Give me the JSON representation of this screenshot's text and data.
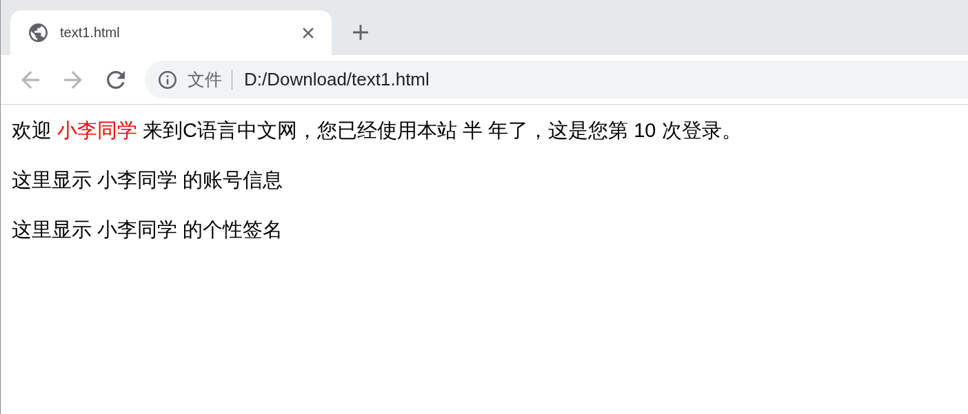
{
  "tabs": [
    {
      "title": "text1.html",
      "selected": true
    }
  ],
  "nav_buttons": [
    {
      "kind": "back",
      "disabled": true
    },
    {
      "kind": "forward",
      "disabled": true
    },
    {
      "kind": "reload",
      "disabled": false
    }
  ],
  "address_bar": {
    "security_label": "文件",
    "url": "D:/Download/text1.html"
  },
  "page": {
    "paragraphs": [
      {
        "segments": [
          {
            "text": "欢迎 ",
            "color": "#000000"
          },
          {
            "text": "小李同学",
            "color": "#ff0000"
          },
          {
            "text": " 来到C语言中文网，您已经使用本站 半 年了，这是您第 10 次登录。",
            "color": "#000000"
          }
        ]
      },
      {
        "segments": [
          {
            "text": "这里显示 小李同学 的账号信息",
            "color": "#000000"
          }
        ]
      },
      {
        "segments": [
          {
            "text": "这里显示 小李同学 的个性签名",
            "color": "#000000"
          }
        ]
      }
    ]
  }
}
